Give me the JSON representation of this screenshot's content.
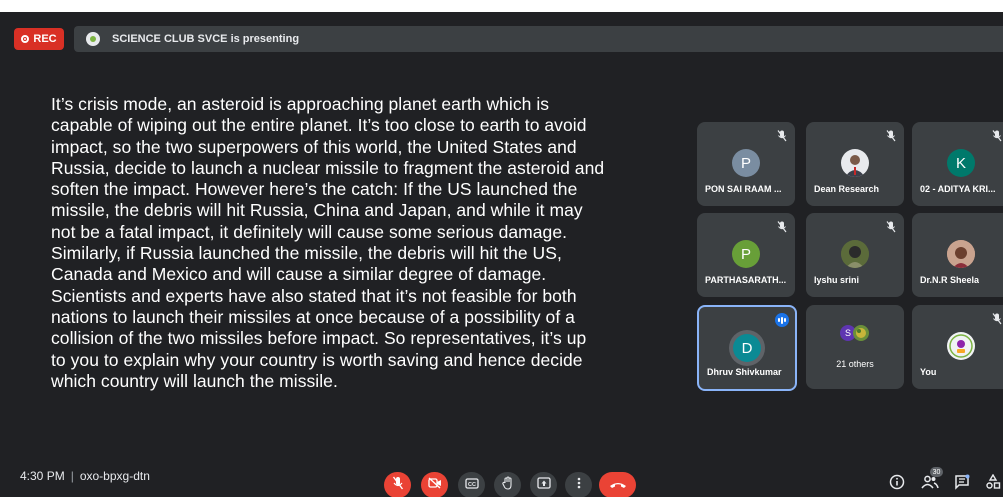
{
  "recording": {
    "label": "REC"
  },
  "presentation": {
    "banner": "SCIENCE CLUB SVCE is presenting"
  },
  "slide": {
    "lines": [
      "It’s crisis mode, an asteroid is approaching planet earth which is",
      "capable of wiping out the entire planet. It’s too close to earth to avoid",
      "impact, so the two superpowers of this world, the United States and",
      "Russia, decide to launch a nuclear missile to fragment the asteroid and",
      "soften the impact. However here’s the catch: If the US launched the",
      "missile, the debris will hit Russia, China and Japan, and while it may",
      "not be a fatal impact, it definitely will cause some serious damage.",
      "Similarly, if Russia launched the missile, the debris will hit the US,",
      "Canada and Mexico and will cause a similar degree of damage.",
      "Scientists and experts have also stated that it’s not feasible for both",
      "nations to launch their missiles at once because of a possibility of a",
      "collision of the two missiles before impact. So representatives, it’s up",
      "to you to explain why your country is worth saving and hence decide",
      "which country will launch the missile."
    ]
  },
  "participants": [
    {
      "name": "PON SAI RAAM ...",
      "initial": "P",
      "avatar_color": "#7a8da1",
      "avatar_type": "letter",
      "muted": true
    },
    {
      "name": "Dean Research",
      "initial": "",
      "avatar_color": "#e8eaed",
      "avatar_type": "photo",
      "muted": true
    },
    {
      "name": "02 - ADITYA KRI...",
      "initial": "K",
      "avatar_color": "#00796b",
      "avatar_type": "letter",
      "muted": true
    },
    {
      "name": "PARTHASARATH...",
      "initial": "P",
      "avatar_color": "#689f38",
      "avatar_type": "letter",
      "muted": true
    },
    {
      "name": "Iyshu srini",
      "initial": "",
      "avatar_color": "#4a5a3a",
      "avatar_type": "photo",
      "muted": true
    },
    {
      "name": "Dr.N.R Sheela",
      "initial": "",
      "avatar_color": "#b58a7a",
      "avatar_type": "photo",
      "muted": false
    },
    {
      "name": "Dhruv Shivkumar",
      "initial": "D",
      "avatar_color": "#0b8a94",
      "avatar_type": "letter",
      "muted": false,
      "speaking": true
    },
    {
      "name": "21 others",
      "initial": "S",
      "avatar_color": "#5e35b1",
      "avatar_type": "group",
      "muted": false
    },
    {
      "name": "You",
      "initial": "",
      "avatar_color": "#f1f3f4",
      "avatar_type": "photo",
      "muted": true
    }
  ],
  "footer": {
    "time": "4:30 PM",
    "meeting_code": "oxo-bpxg-dtn",
    "people_count": "30"
  },
  "colors": {
    "background": "#202124",
    "tile": "#3c4043",
    "danger": "#ea4335",
    "active_border": "#8ab4f8"
  },
  "icons": {
    "controls": [
      "mic-off-icon",
      "camera-off-icon",
      "captions-icon",
      "raise-hand-icon",
      "present-icon",
      "more-options-icon",
      "end-call-icon"
    ],
    "right": [
      "info-icon",
      "people-icon",
      "chat-icon",
      "activities-icon"
    ]
  }
}
